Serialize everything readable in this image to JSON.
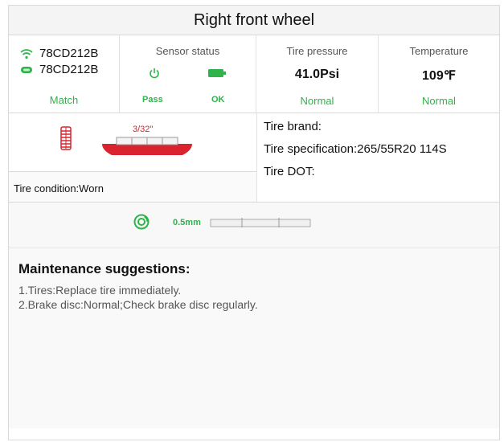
{
  "header": {
    "title": "Right front wheel"
  },
  "sensor": {
    "id_1": "78CD212B",
    "id_2": "78CD212B",
    "match_label": "Match",
    "status_header": "Sensor status",
    "power_status": "Pass",
    "battery_status": "OK"
  },
  "pressure": {
    "header": "Tire pressure",
    "value": "41.0Psi",
    "status": "Normal"
  },
  "temperature": {
    "header": "Temperature",
    "value": "109℉",
    "status": "Normal"
  },
  "tread": {
    "depth_label": "3/32\"",
    "condition": "Tire condition:Worn"
  },
  "tire_info": {
    "brand": "Tire brand:",
    "specification": "Tire specification:265/55R20 114S",
    "dot": "Tire DOT:"
  },
  "brake": {
    "thickness": "0.5mm"
  },
  "maintenance": {
    "title": "Maintenance suggestions:",
    "items": [
      "1.Tires:Replace tire immediately.",
      "2.Brake disc:Normal;Check brake disc regularly."
    ]
  },
  "colors": {
    "accent_green": "#2fb34a",
    "warning_red": "#d9232e"
  },
  "icons": [
    "wifi-icon",
    "tire-sensor-icon",
    "power-icon",
    "battery-icon",
    "tread-icon",
    "brake-disc-icon"
  ]
}
